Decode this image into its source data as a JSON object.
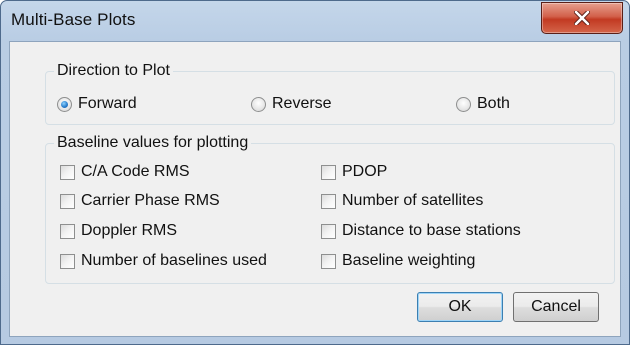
{
  "window": {
    "title": "Multi-Base Plots"
  },
  "direction": {
    "legend": "Direction to Plot",
    "options": [
      {
        "label": "Forward",
        "selected": true
      },
      {
        "label": "Reverse",
        "selected": false
      },
      {
        "label": "Both",
        "selected": false
      }
    ]
  },
  "baseline": {
    "legend": "Baseline values for plotting",
    "left": [
      {
        "label": "C/A Code RMS",
        "checked": false
      },
      {
        "label": "Carrier Phase RMS",
        "checked": false
      },
      {
        "label": "Doppler RMS",
        "checked": false
      },
      {
        "label": "Number of baselines used",
        "checked": false
      }
    ],
    "right": [
      {
        "label": "PDOP",
        "checked": false
      },
      {
        "label": "Number of satellites",
        "checked": false
      },
      {
        "label": "Distance to base stations",
        "checked": false
      },
      {
        "label": "Baseline weighting",
        "checked": false
      }
    ]
  },
  "buttons": {
    "ok": "OK",
    "cancel": "Cancel"
  },
  "icons": {
    "close": "close-x-icon"
  }
}
